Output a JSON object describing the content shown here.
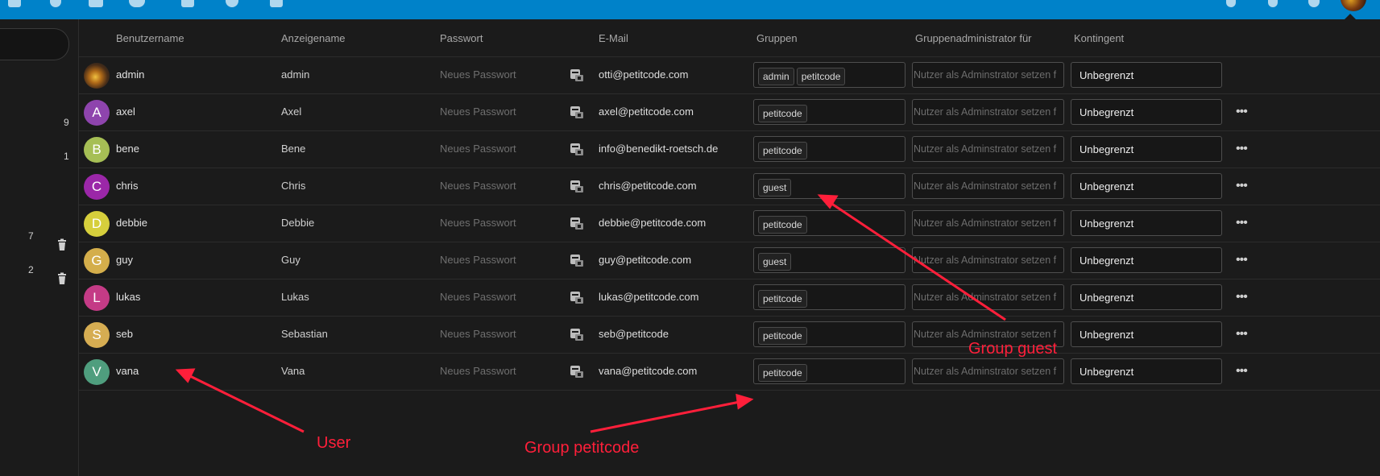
{
  "columns": {
    "username": "Benutzername",
    "displayname": "Anzeigename",
    "password": "Passwort",
    "email": "E-Mail",
    "groups": "Gruppen",
    "groupadmin": "Gruppenadministrator für",
    "quota": "Kontingent"
  },
  "sidebar": {
    "counts": [
      "9",
      "1",
      "7",
      "2"
    ]
  },
  "users": [
    {
      "avatar_letter": "",
      "avatar_color": "#c08a20",
      "username": "admin",
      "displayname": "admin",
      "password_placeholder": "Neues Passwort",
      "email": "otti@petitcode.com",
      "groups": [
        "admin",
        "petitcode"
      ],
      "admin_placeholder": "Nutzer als Adminstrator setzen f",
      "quota": "Unbegrenzt",
      "has_menu": false
    },
    {
      "avatar_letter": "A",
      "avatar_color": "#8e44ad",
      "username": "axel",
      "displayname": "Axel",
      "password_placeholder": "Neues Passwort",
      "email": "axel@petitcode.com",
      "groups": [
        "petitcode"
      ],
      "admin_placeholder": "Nutzer als Adminstrator setzen f",
      "quota": "Unbegrenzt",
      "has_menu": true
    },
    {
      "avatar_letter": "B",
      "avatar_color": "#a6bf55",
      "username": "bene",
      "displayname": "Bene",
      "password_placeholder": "Neues Passwort",
      "email": "info@benedikt-roetsch.de",
      "groups": [
        "petitcode"
      ],
      "admin_placeholder": "Nutzer als Adminstrator setzen f",
      "quota": "Unbegrenzt",
      "has_menu": true
    },
    {
      "avatar_letter": "C",
      "avatar_color": "#9b27a8",
      "username": "chris",
      "displayname": "Chris",
      "password_placeholder": "Neues Passwort",
      "email": "chris@petitcode.com",
      "groups": [
        "guest"
      ],
      "admin_placeholder": "Nutzer als Adminstrator setzen f",
      "quota": "Unbegrenzt",
      "has_menu": true
    },
    {
      "avatar_letter": "D",
      "avatar_color": "#d6cf3c",
      "username": "debbie",
      "displayname": "Debbie",
      "password_placeholder": "Neues Passwort",
      "email": "debbie@petitcode.com",
      "groups": [
        "petitcode"
      ],
      "admin_placeholder": "Nutzer als Adminstrator setzen f",
      "quota": "Unbegrenzt",
      "has_menu": true
    },
    {
      "avatar_letter": "G",
      "avatar_color": "#d4ae4b",
      "username": "guy",
      "displayname": "Guy",
      "password_placeholder": "Neues Passwort",
      "email": "guy@petitcode.com",
      "groups": [
        "guest"
      ],
      "admin_placeholder": "Nutzer als Adminstrator setzen f",
      "quota": "Unbegrenzt",
      "has_menu": true
    },
    {
      "avatar_letter": "L",
      "avatar_color": "#c43b86",
      "username": "lukas",
      "displayname": "Lukas",
      "password_placeholder": "Neues Passwort",
      "email": "lukas@petitcode.com",
      "groups": [
        "petitcode"
      ],
      "admin_placeholder": "Nutzer als Adminstrator setzen f",
      "quota": "Unbegrenzt",
      "has_menu": true
    },
    {
      "avatar_letter": "S",
      "avatar_color": "#d6ad52",
      "username": "seb",
      "displayname": "Sebastian",
      "password_placeholder": "Neues Passwort",
      "email": "seb@petitcode",
      "groups": [
        "petitcode"
      ],
      "admin_placeholder": "Nutzer als Adminstrator setzen f",
      "quota": "Unbegrenzt",
      "has_menu": true
    },
    {
      "avatar_letter": "V",
      "avatar_color": "#4f9e7e",
      "username": "vana",
      "displayname": "Vana",
      "password_placeholder": "Neues Passwort",
      "email": "vana@petitcode.com",
      "groups": [
        "petitcode"
      ],
      "admin_placeholder": "Nutzer als Adminstrator setzen f",
      "quota": "Unbegrenzt",
      "has_menu": true
    }
  ],
  "annotations": {
    "group_guest": "Group guest",
    "user": "User",
    "group_petitcode": "Group petitcode",
    "color": "#ff1f3a"
  },
  "theme": {
    "header_blue": "#0082c9",
    "background": "#1b1b1b"
  }
}
